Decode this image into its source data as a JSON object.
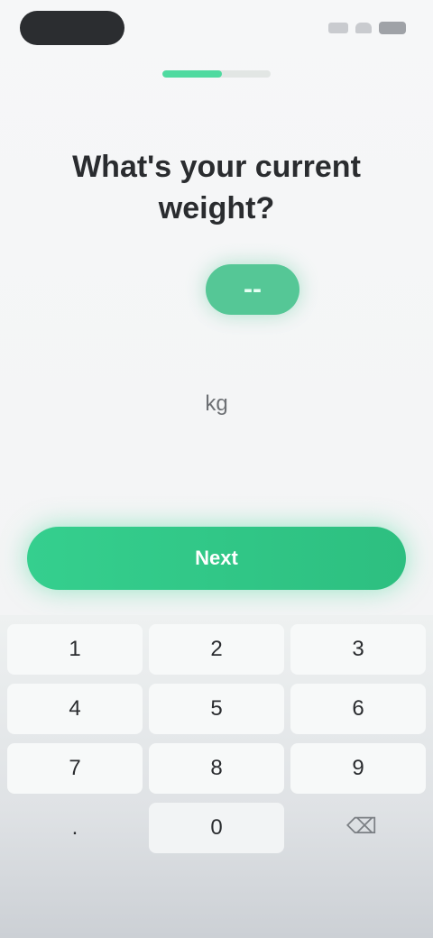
{
  "status_bar": {
    "icons": [
      "signal-icon",
      "wifi-icon",
      "battery-icon"
    ]
  },
  "progress": {
    "fraction": 0.55,
    "color": "#4fdaa0"
  },
  "question": {
    "title": "What's your current weight?"
  },
  "value": {
    "number": "--",
    "unit": "kg",
    "accent": "#55c796"
  },
  "next_button": {
    "label": "Next",
    "color": "#35cf8e"
  },
  "keypad": {
    "keys": [
      "1",
      "2",
      "3",
      "4",
      "5",
      "6",
      "7",
      "8",
      "9",
      ".",
      "0",
      ""
    ],
    "backspace_icon": "backspace-icon"
  }
}
